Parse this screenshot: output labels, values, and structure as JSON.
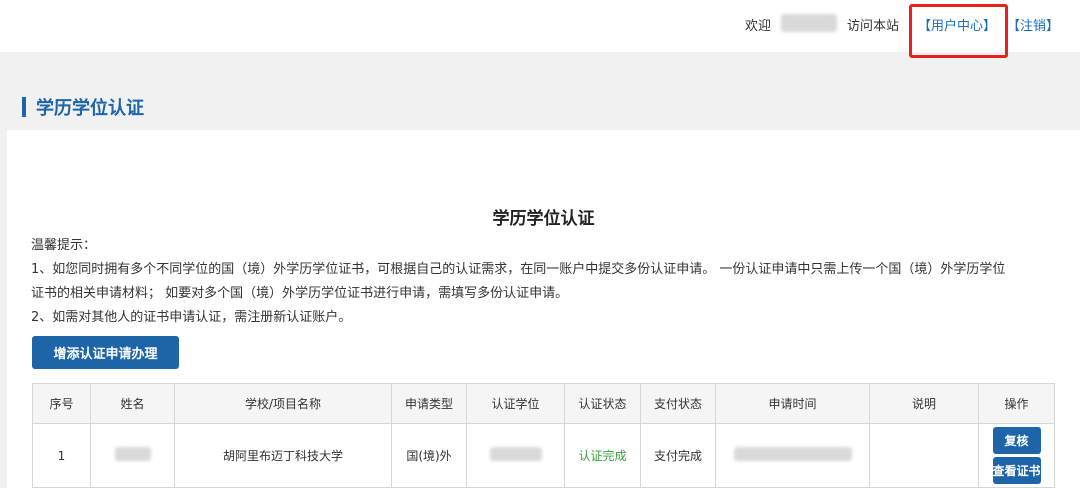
{
  "header": {
    "welcome": "欢迎",
    "visit": "访问本站",
    "user_center": "【用户中心】",
    "logout": "【注销】",
    "highlight_color": "#e8211a"
  },
  "section": {
    "title": "学历学位认证"
  },
  "main": {
    "title": "学历学位认证",
    "tips": [
      "温馨提示：",
      "1、如您同时拥有多个不同学位的国（境）外学历学位证书，可根据自己的认证需求，在同一账户中提交多份认证申请。 一份认证申请中只需上传一个国（境）外学历学位",
      "证书的相关申请材料； 如要对多个国（境）外学历学位证书进行申请，需填写多份认证申请。",
      "2、如需对其他人的证书申请认证，需注册新认证账户。"
    ],
    "add_button": "增添认证申请办理"
  },
  "table": {
    "headers": [
      "序号",
      "姓名",
      "学校/项目名称",
      "申请类型",
      "认证学位",
      "认证状态",
      "支付状态",
      "申请时间",
      "说明",
      "操作"
    ],
    "rows": [
      {
        "index": "1",
        "school": "胡阿里布迈丁科技大学",
        "type": "国(境)外",
        "status": "认证完成",
        "payment": "支付完成",
        "note": "",
        "actions": [
          "复核",
          "查看证书"
        ]
      }
    ]
  },
  "colors": {
    "primary": "#1d64a8",
    "success": "#3aa53a"
  }
}
